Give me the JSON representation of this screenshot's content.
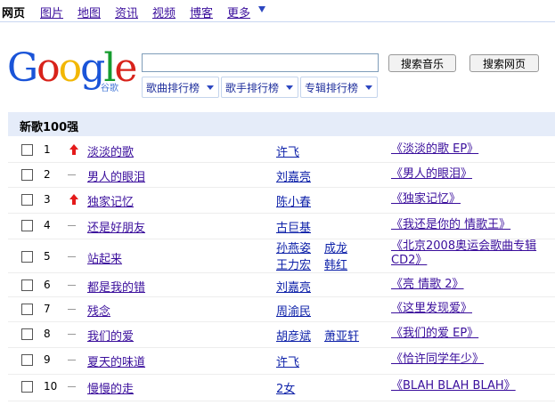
{
  "nav": {
    "items": [
      "网页",
      "图片",
      "地图",
      "资讯",
      "视频",
      "博客",
      "更多"
    ],
    "current_index": 0
  },
  "logo": {
    "wordmark_letters": [
      "G",
      "o",
      "o",
      "g",
      "l",
      "e"
    ],
    "sub": "谷歌",
    "colors": [
      "#1a54d8",
      "#d8231b",
      "#f2b705",
      "#1a54d8",
      "#169c2e",
      "#d8231b"
    ]
  },
  "search": {
    "value": "",
    "placeholder": "",
    "music_button": "搜索音乐",
    "web_button": "搜索网页"
  },
  "dropdowns": [
    "歌曲排行榜",
    "歌手排行榜",
    "专辑排行榜"
  ],
  "section_title": "新歌100强",
  "colors": {
    "section_bg": "#e5ecf9",
    "up_arrow": "#e41a1a",
    "link": "#3a0e9c"
  },
  "rows": [
    {
      "rank": "1",
      "trend": "up",
      "song": "淡淡的歌",
      "artists": [
        "许飞"
      ],
      "album": "《淡淡的歌 EP》"
    },
    {
      "rank": "2",
      "trend": "same",
      "song": "男人的眼泪",
      "artists": [
        "刘嘉亮"
      ],
      "album": "《男人的眼泪》"
    },
    {
      "rank": "3",
      "trend": "up",
      "song": "独家记忆",
      "artists": [
        "陈小春"
      ],
      "album": "《独家记忆》"
    },
    {
      "rank": "4",
      "trend": "same",
      "song": "还是好朋友",
      "artists": [
        "古巨基"
      ],
      "album": "《我还是你的 情歌王》"
    },
    {
      "rank": "5",
      "trend": "same",
      "song": "站起来",
      "artists": [
        "孙燕姿",
        "成龙",
        "王力宏",
        "韩红"
      ],
      "album": "《北京2008奥运会歌曲专辑CD2》"
    },
    {
      "rank": "6",
      "trend": "same",
      "song": "都是我的错",
      "artists": [
        "刘嘉亮"
      ],
      "album": "《亮 情歌 2》"
    },
    {
      "rank": "7",
      "trend": "same",
      "song": "残念",
      "artists": [
        "周渝民"
      ],
      "album": "《这里发现爱》"
    },
    {
      "rank": "8",
      "trend": "same",
      "song": "我们的爱",
      "artists": [
        "胡彦斌",
        "萧亚轩"
      ],
      "album": "《我们的爱 EP》"
    },
    {
      "rank": "9",
      "trend": "same",
      "song": "夏天的味道",
      "artists": [
        "许飞"
      ],
      "album": "《恰许同学年少》"
    },
    {
      "rank": "10",
      "trend": "same",
      "song": "慢慢的走",
      "artists": [
        "2女"
      ],
      "album": "《BLAH BLAH BLAH》"
    }
  ]
}
